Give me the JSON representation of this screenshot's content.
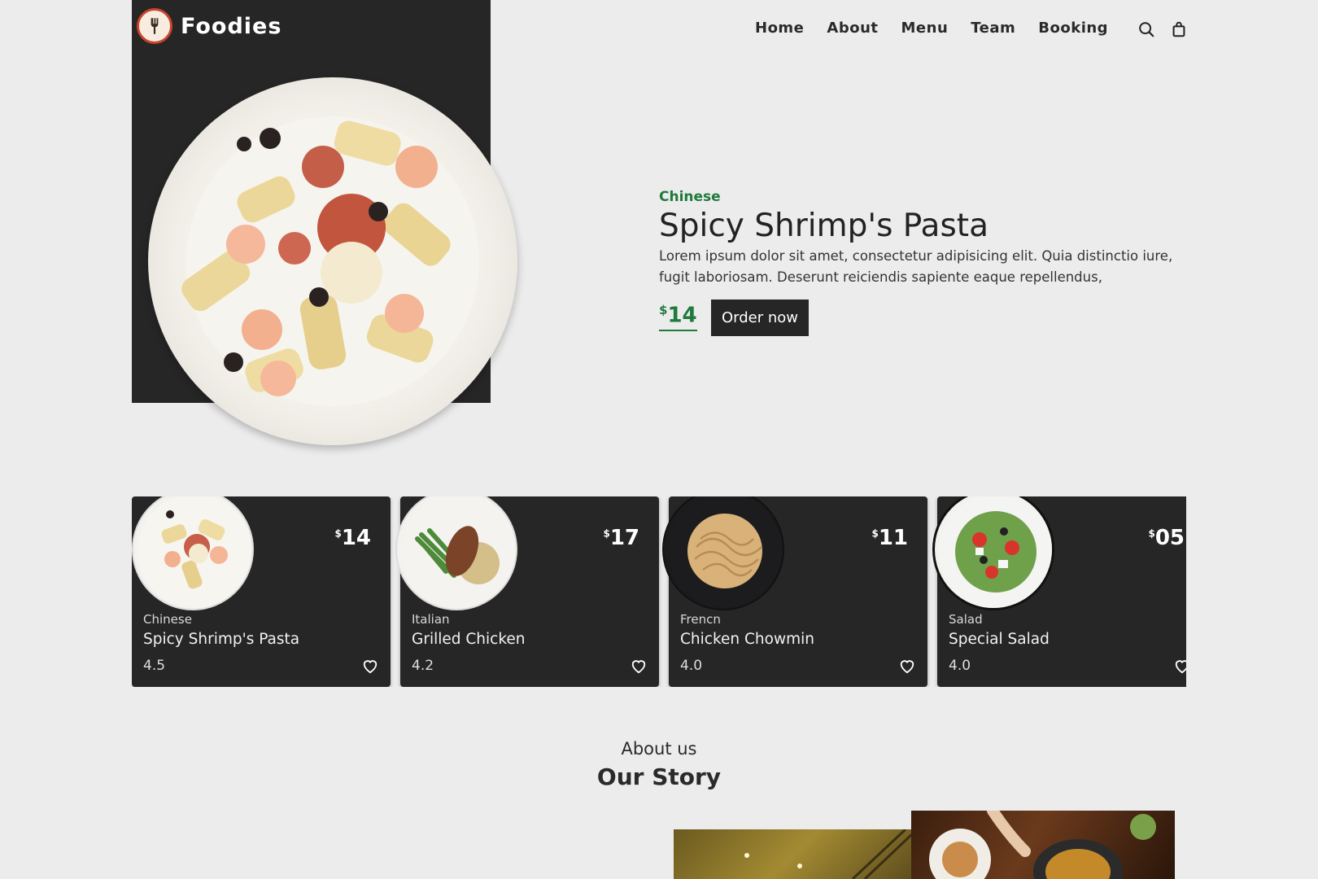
{
  "brand": {
    "name": "Foodies",
    "logo_icon": "fork-icon"
  },
  "nav": {
    "items": [
      "Home",
      "About",
      "Menu",
      "Team",
      "Booking"
    ],
    "icons": [
      "search-icon",
      "shopping-bag-icon"
    ]
  },
  "hero": {
    "category": "Chinese",
    "title": "Spicy Shrimp's Pasta",
    "description": "Lorem ipsum dolor sit amet, consectetur adipisicing elit. Quia distinctio iure, fugit laboriosam. Deserunt reiciendis sapiente eaque repellendus,",
    "currency": "$",
    "price": "14",
    "order_label": "Order now"
  },
  "cards": [
    {
      "category": "Chinese",
      "name": "Spicy Shrimp's Pasta",
      "rating": "4.5",
      "currency": "$",
      "price": "14"
    },
    {
      "category": "Italian",
      "name": "Grilled Chicken",
      "rating": "4.2",
      "currency": "$",
      "price": "17"
    },
    {
      "category": "Frencn",
      "name": "Chicken Chowmin",
      "rating": "4.0",
      "currency": "$",
      "price": "11"
    },
    {
      "category": "Salad",
      "name": "Special Salad",
      "rating": "4.0",
      "currency": "$",
      "price": "05"
    }
  ],
  "about": {
    "label": "About us",
    "title": "Our Story"
  },
  "colors": {
    "accent": "#1f7a3c",
    "dark": "#262626",
    "background": "#ececec",
    "logo_ring": "#c9442b"
  }
}
